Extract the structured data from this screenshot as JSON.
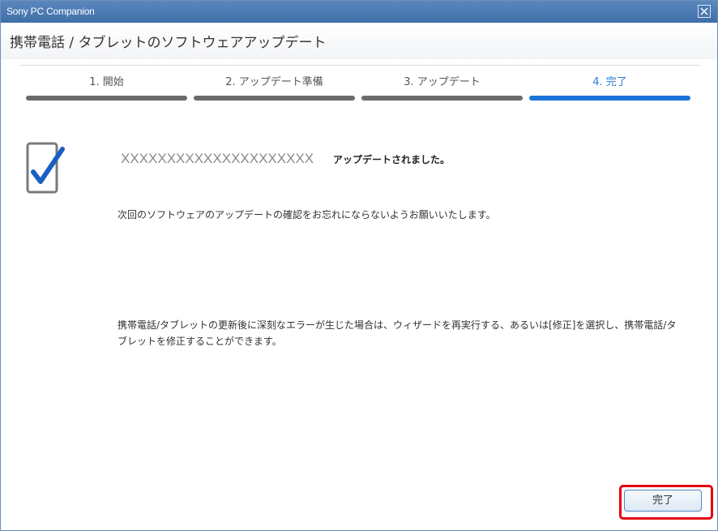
{
  "window": {
    "title": "Sony PC Companion"
  },
  "header": {
    "title": "携帯電話 / タブレットのソフトウェアアップデート"
  },
  "steps": [
    {
      "label": "1. 開始",
      "active": false
    },
    {
      "label": "2. アップデート準備",
      "active": false
    },
    {
      "label": "3. アップデート",
      "active": false
    },
    {
      "label": "4. 完了",
      "active": true
    }
  ],
  "content": {
    "device_name": "XXXXXXXXXXXXXXXXXXXXX",
    "updated_message": "アップデートされました。",
    "reminder": "次回のソフトウェアのアップデートの確認をお忘れにならないようお願いいたします。",
    "repair_note": "携帯電話/タブレットの更新後に深刻なエラーが生じた場合は、ウィザードを再実行する、あるいは[修正]を選択し、携帯電話/タブレットを修正することができます。"
  },
  "footer": {
    "finish_label": "完了"
  },
  "colors": {
    "accent": "#1a73d6",
    "titlebar": "#4a78b3",
    "highlight": "#e60012"
  },
  "icons": {
    "device": "phone-check-icon",
    "close": "close-icon"
  }
}
